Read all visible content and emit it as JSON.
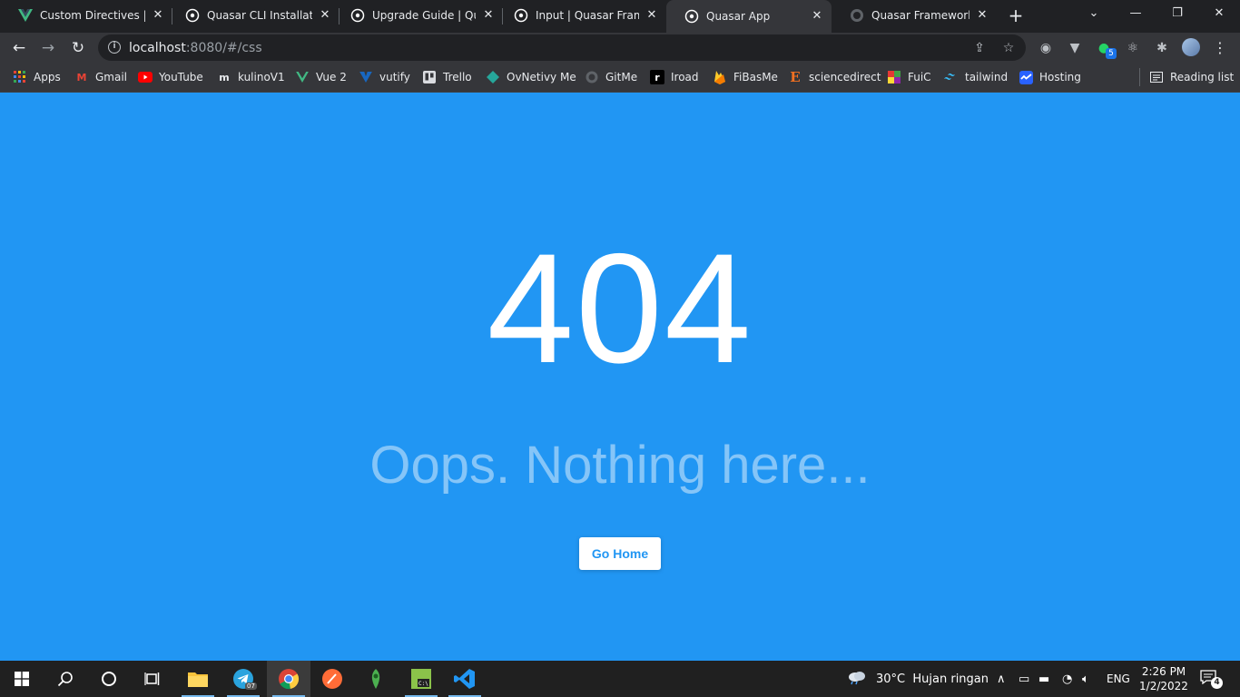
{
  "browser": {
    "tabs": [
      {
        "title": "Custom Directives | Vue",
        "icon": "vue-icon"
      },
      {
        "title": "Quasar CLI Installation",
        "icon": "quasar-icon"
      },
      {
        "title": "Upgrade Guide | Quasar",
        "icon": "quasar-icon"
      },
      {
        "title": "Input | Quasar Framework",
        "icon": "quasar-icon"
      },
      {
        "title": "Quasar App",
        "icon": "quasar-icon",
        "active": true
      },
      {
        "title": "Quasar Framework",
        "icon": "github-icon"
      }
    ],
    "new_tab": "+",
    "window_controls": {
      "minimize": "—",
      "restore": "❐",
      "close": "✕",
      "tab_search": "⌄"
    },
    "url_host": "localhost",
    "url_rest": ":8080/#/css",
    "extension_badge": "5",
    "bookmarks": [
      {
        "label": "Apps",
        "icon": "apps-grid-icon"
      },
      {
        "label": "Gmail",
        "icon": "gmail-icon"
      },
      {
        "label": "YouTube",
        "icon": "youtube-icon"
      },
      {
        "label": "kulinoV1",
        "icon": "kulino-icon"
      },
      {
        "label": "Vue 2",
        "icon": "vue-icon"
      },
      {
        "label": "vutify",
        "icon": "vuetify-icon"
      },
      {
        "label": "Trello",
        "icon": "trello-icon"
      },
      {
        "label": "OvNetivy Me",
        "icon": "diamond-icon"
      },
      {
        "label": "GitMe",
        "icon": "github-icon"
      },
      {
        "label": "Iroad",
        "icon": "iroad-icon"
      },
      {
        "label": "FiBasMe",
        "icon": "firebase-icon"
      },
      {
        "label": "sciencedirect",
        "icon": "elsevier-icon"
      },
      {
        "label": "FuiC",
        "icon": "fuic-icon"
      },
      {
        "label": "tailwind",
        "icon": "tailwind-icon"
      },
      {
        "label": "Hosting",
        "icon": "hosting-icon"
      }
    ],
    "reading_list": "Reading list"
  },
  "page": {
    "code": "404",
    "message": "Oops. Nothing here...",
    "button": "Go Home"
  },
  "taskbar": {
    "weather": "30°C  Hujan ringan",
    "language": "ENG",
    "time": "2:26 PM",
    "date": "1/2/2022",
    "notifications": "4",
    "telegram_badge": "07"
  },
  "colors": {
    "page_bg": "#2196f3",
    "button_text": "#2196f3",
    "chrome_dark": "#202124",
    "chrome_toolbar": "#35363a"
  }
}
